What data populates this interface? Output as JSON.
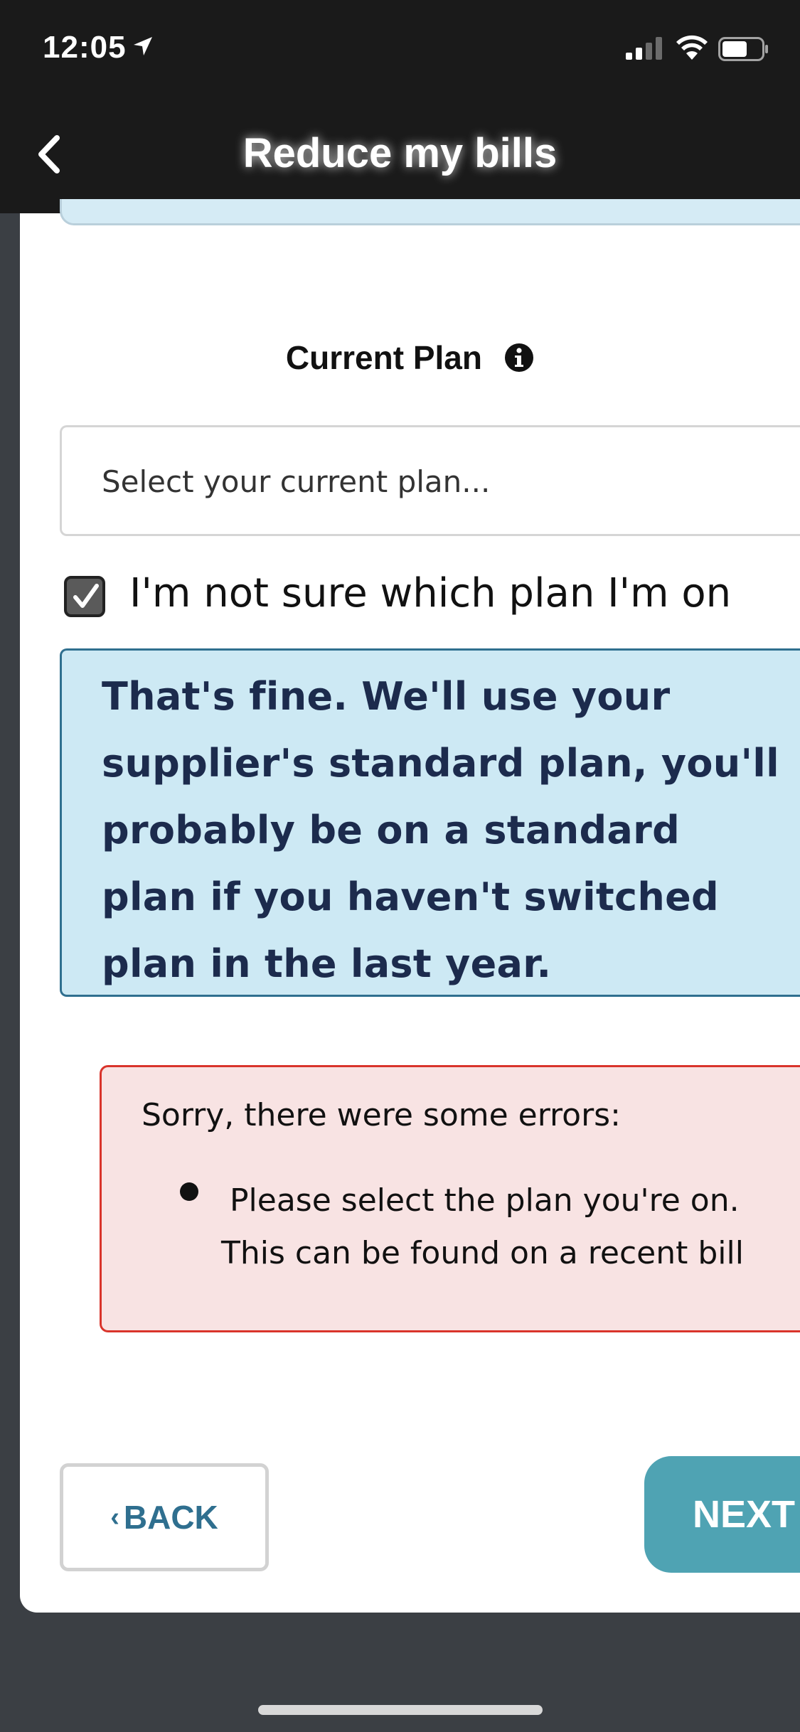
{
  "status_bar": {
    "time": "12:05"
  },
  "nav": {
    "title": "Reduce my bills"
  },
  "form": {
    "current_plan_label": "Current Plan",
    "plan_select_placeholder": "Select your current plan...",
    "not_sure_checkbox": {
      "label": "I'm not sure which plan I'm on",
      "checked": true
    },
    "info_message": "That's fine. We'll use your supplier's standard plan, you'll probably be on a standard plan if you haven't switched plan in the last year.",
    "errors": {
      "heading": "Sorry, there were some errors:",
      "items": [
        {
          "line1": "Please select the plan you're on.",
          "line2": "This can be found on a recent bill"
        }
      ]
    }
  },
  "footer_buttons": {
    "back_label": "BACK",
    "next_label": "NEXT"
  },
  "colors": {
    "header_bg": "#1a1a1a",
    "info_bg": "#cde9f4",
    "info_border": "#2f6f8f",
    "error_bg": "#f8e3e3",
    "error_border": "#d9342b",
    "accent": "#4fa3b3"
  },
  "icons": {
    "back": "chevron-left-icon",
    "info": "info-circle-icon",
    "location": "location-arrow-icon",
    "signal": "cellular-signal-icon",
    "wifi": "wifi-icon",
    "battery": "battery-icon",
    "check": "checkmark-icon"
  }
}
